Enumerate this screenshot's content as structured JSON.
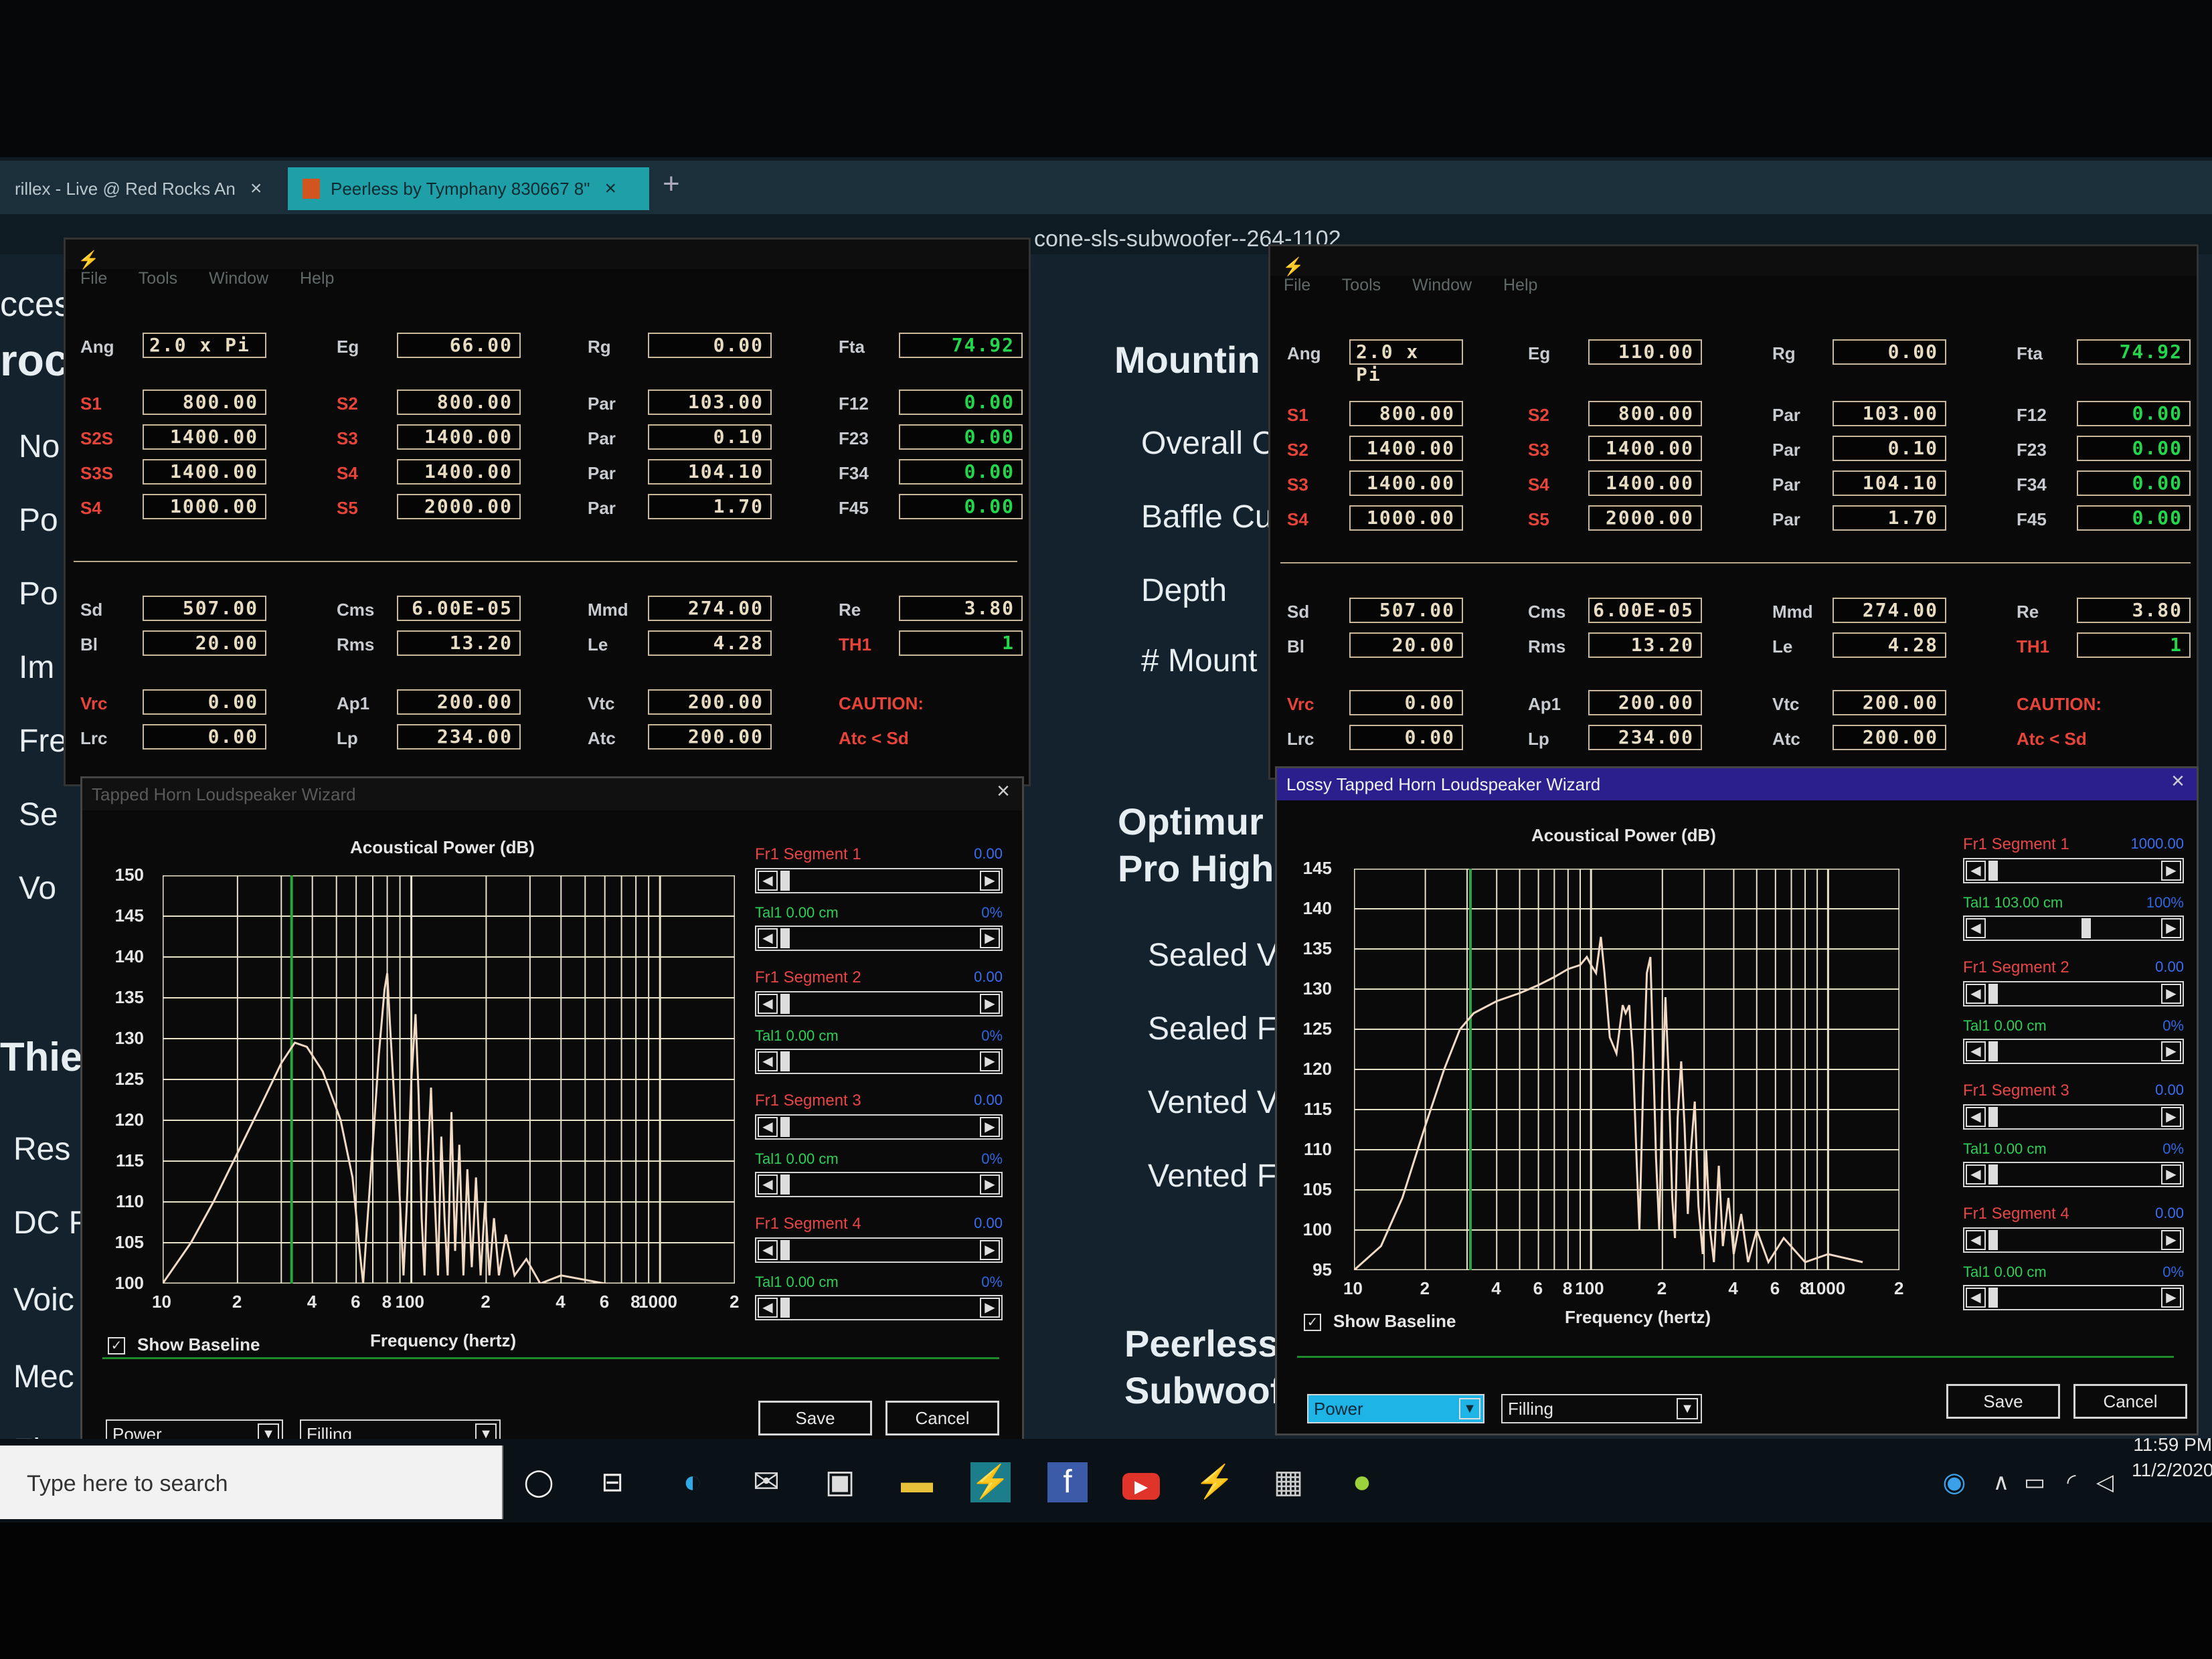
{
  "browser": {
    "tabs": [
      {
        "label": "rillex - Live @ Red Rocks An",
        "close": "×"
      },
      {
        "label": "Peerless by Tymphany 830667 8\"",
        "close": "×"
      }
    ],
    "new_tab": "+",
    "url_fragment": "cone-sls-subwoofer--264-1102"
  },
  "page": {
    "left_fragments": [
      "cces",
      "roc",
      "No",
      "Po",
      "Po",
      "Im",
      "Fre",
      "Se",
      "Vo",
      "Thiel",
      "Res",
      "DC F",
      "Voic",
      "Mec",
      "Flec"
    ],
    "middle_fragments": [
      "Mountin",
      "Overall C",
      "Baffle Cu",
      "Depth",
      "# Mount",
      "Optimur",
      "Pro High",
      "Sealed V",
      "Sealed F",
      "Vented V",
      "Vented F",
      "Peerless",
      "Subwoof"
    ]
  },
  "hornresp_left": {
    "menu": [
      "File",
      "Tools",
      "Window",
      "Help"
    ],
    "row1": {
      "Ang": "2.0 x Pi",
      "Eg": "66.00",
      "Rg": "0.00",
      "Fta": "74.92"
    },
    "rows": [
      {
        "a": "S1",
        "av": "800.00",
        "b": "S2",
        "bv": "800.00",
        "c": "Par",
        "cv": "103.00",
        "d": "F12",
        "dv": "0.00"
      },
      {
        "a": "S2S",
        "av": "1400.00",
        "b": "S3",
        "bv": "1400.00",
        "c": "Par",
        "cv": "0.10",
        "d": "F23",
        "dv": "0.00"
      },
      {
        "a": "S3S",
        "av": "1400.00",
        "b": "S4",
        "bv": "1400.00",
        "c": "Par",
        "cv": "104.10",
        "d": "F34",
        "dv": "0.00"
      },
      {
        "a": "S4",
        "av": "1000.00",
        "b": "S5",
        "bv": "2000.00",
        "c": "Par",
        "cv": "1.70",
        "d": "F45",
        "dv": "0.00"
      }
    ],
    "driver": {
      "Sd": "507.00",
      "Cms": "6.00E-05",
      "Mmd": "274.00",
      "Re": "3.80",
      "Bl": "20.00",
      "Rms": "13.20",
      "Le": "4.28",
      "TH1": "1",
      "Vrc": "0.00",
      "Ap1": "200.00",
      "Vtc": "200.00",
      "Lrc": "0.00",
      "Lp": "234.00",
      "Atc": "200.00"
    },
    "caution": "CAUTION:",
    "caution_detail": "Atc < Sd"
  },
  "hornresp_right": {
    "menu": [
      "File",
      "Tools",
      "Window",
      "Help"
    ],
    "row1": {
      "Ang": "2.0 x Pi",
      "Eg": "110.00",
      "Rg": "0.00",
      "Fta": "74.92"
    },
    "rows": [
      {
        "a": "S1",
        "av": "800.00",
        "b": "S2",
        "bv": "800.00",
        "c": "Par",
        "cv": "103.00",
        "d": "F12",
        "dv": "0.00"
      },
      {
        "a": "S2",
        "av": "1400.00",
        "b": "S3",
        "bv": "1400.00",
        "c": "Par",
        "cv": "0.10",
        "d": "F23",
        "dv": "0.00"
      },
      {
        "a": "S3",
        "av": "1400.00",
        "b": "S4",
        "bv": "1400.00",
        "c": "Par",
        "cv": "104.10",
        "d": "F34",
        "dv": "0.00"
      },
      {
        "a": "S4",
        "av": "1000.00",
        "b": "S5",
        "bv": "2000.00",
        "c": "Par",
        "cv": "1.70",
        "d": "F45",
        "dv": "0.00"
      }
    ],
    "driver": {
      "Sd": "507.00",
      "Cms": "6.00E-05",
      "Mmd": "274.00",
      "Re": "3.80",
      "Bl": "20.00",
      "Rms": "13.20",
      "Le": "4.28",
      "TH1": "1",
      "Vrc": "0.00",
      "Ap1": "200.00",
      "Vtc": "200.00",
      "Lrc": "0.00",
      "Lp": "234.00",
      "Atc": "200.00"
    },
    "caution": "CAUTION:",
    "caution_detail": "Atc < Sd"
  },
  "wizard_left": {
    "title": "Tapped Horn Loudspeaker Wizard",
    "close": "×",
    "chart_title": "Acoustical Power (dB)",
    "xlabel": "Frequency (hertz)",
    "yticks": [
      "150",
      "145",
      "140",
      "135",
      "130",
      "125",
      "120",
      "115",
      "110",
      "105",
      "100"
    ],
    "xticks": [
      "10",
      "2",
      "4",
      "6",
      "8",
      "100",
      "2",
      "4",
      "6",
      "8",
      "1000",
      "2"
    ],
    "segments": [
      {
        "label": "Fr1  Segment 1",
        "value": "0.00",
        "tal": "Tal1  0.00 cm",
        "pct": "0%"
      },
      {
        "label": "Fr1  Segment 2",
        "value": "0.00",
        "tal": "Tal1  0.00 cm",
        "pct": "0%"
      },
      {
        "label": "Fr1  Segment 3",
        "value": "0.00",
        "tal": "Tal1  0.00 cm",
        "pct": "0%"
      },
      {
        "label": "Fr1  Segment 4",
        "value": "0.00",
        "tal": "Tal1  0.00 cm",
        "pct": "0%"
      }
    ],
    "show_baseline": "Show Baseline",
    "save": "Save",
    "cancel": "Cancel",
    "dropdown1": "Power",
    "dropdown2": "Filling"
  },
  "wizard_right": {
    "title": "Lossy Tapped Horn Loudspeaker Wizard",
    "close": "×",
    "chart_title": "Acoustical Power (dB)",
    "xlabel": "Frequency (hertz)",
    "yticks": [
      "145",
      "140",
      "135",
      "130",
      "125",
      "120",
      "115",
      "110",
      "105",
      "100",
      "95"
    ],
    "xticks": [
      "10",
      "2",
      "4",
      "6",
      "8",
      "100",
      "2",
      "4",
      "6",
      "8",
      "1000",
      "2"
    ],
    "segments": [
      {
        "label": "Fr1  Segment 1",
        "value": "1000.00",
        "tal": "Tal1  103.00 cm",
        "pct": "100%"
      },
      {
        "label": "Fr1  Segment 2",
        "value": "0.00",
        "tal": "Tal1  0.00 cm",
        "pct": "0%"
      },
      {
        "label": "Fr1  Segment 3",
        "value": "0.00",
        "tal": "Tal1  0.00 cm",
        "pct": "0%"
      },
      {
        "label": "Fr1  Segment 4",
        "value": "0.00",
        "tal": "Tal1  0.00 cm",
        "pct": "0%"
      }
    ],
    "show_baseline": "Show Baseline",
    "save": "Save",
    "cancel": "Cancel",
    "dropdown1": "Power",
    "dropdown2": "Filling"
  },
  "taskbar": {
    "search_placeholder": "Type here to search",
    "time": "11:59 PM",
    "date": "11/2/2020"
  },
  "colors": {
    "field_border": "#c9b89a",
    "red_label": "#e8443a",
    "green_value": "#23d64b",
    "curve": "#f1d9c4",
    "grid": "#e8e2c8",
    "wizard_title_active": "#2a1f8c"
  }
}
